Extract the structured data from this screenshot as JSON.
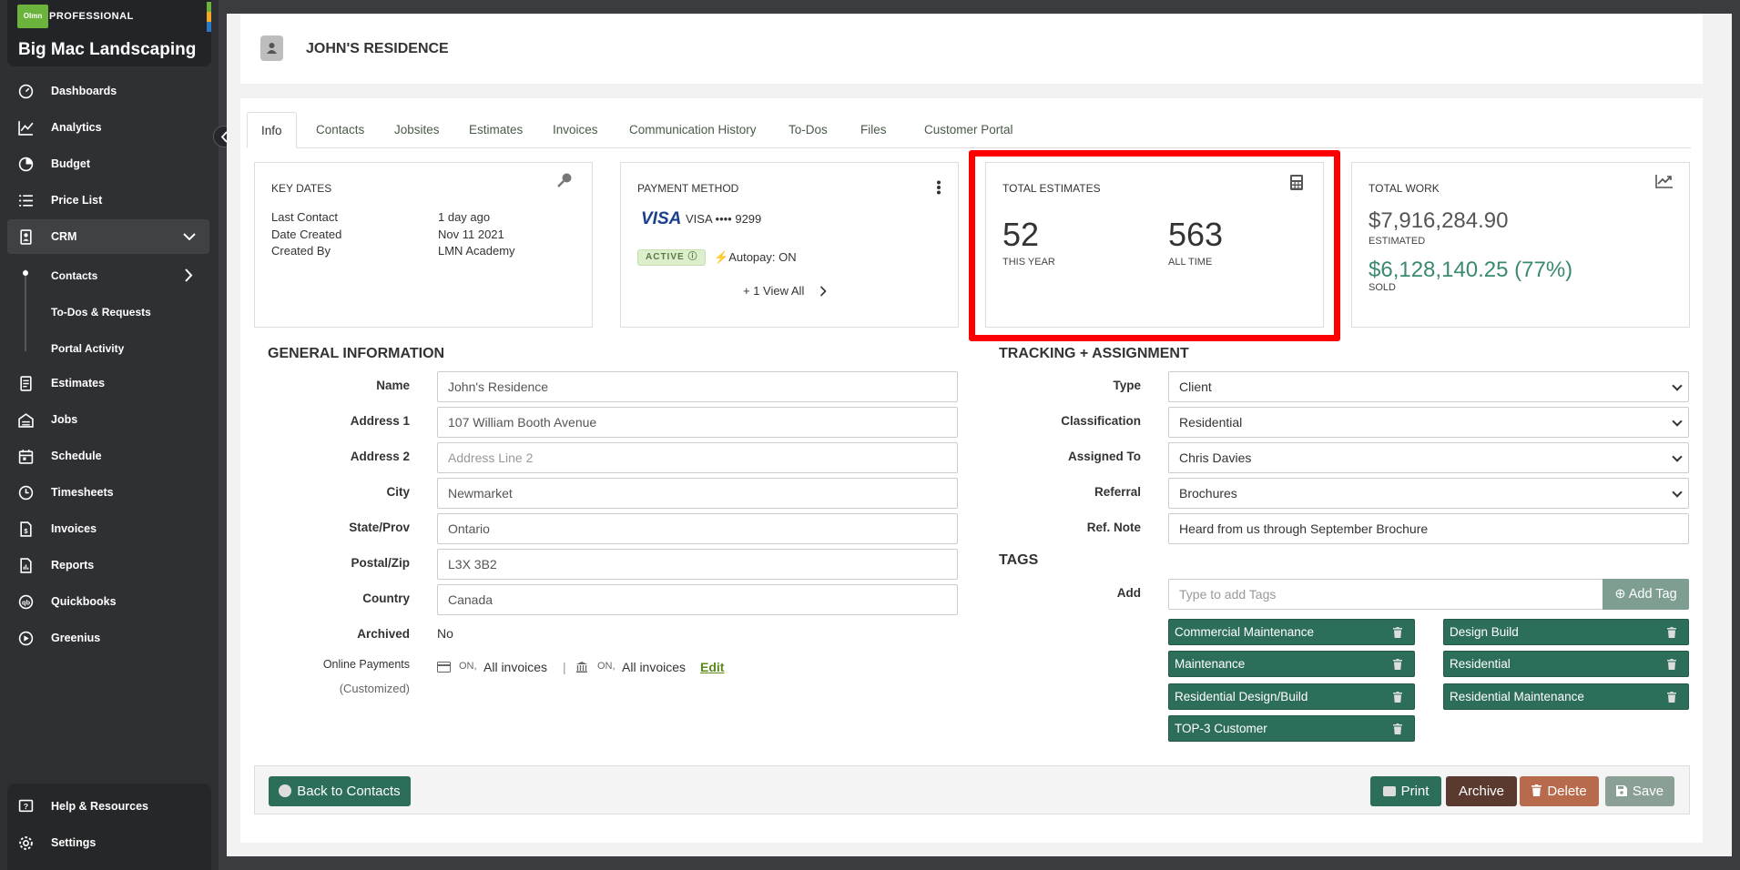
{
  "brand": {
    "logo_text": "Olmn",
    "tier": "PROFESSIONAL",
    "company": "Big Mac Landscaping"
  },
  "nav": [
    {
      "label": "Dashboards",
      "icon": "dashboard-icon"
    },
    {
      "label": "Analytics",
      "icon": "analytics-icon"
    },
    {
      "label": "Budget",
      "icon": "budget-icon"
    },
    {
      "label": "Price List",
      "icon": "price-list-icon"
    },
    {
      "label": "CRM",
      "icon": "crm-icon"
    },
    {
      "label": "Estimates",
      "icon": "estimates-icon"
    },
    {
      "label": "Jobs",
      "icon": "jobs-icon"
    },
    {
      "label": "Schedule",
      "icon": "schedule-icon"
    },
    {
      "label": "Timesheets",
      "icon": "timesheets-icon"
    },
    {
      "label": "Invoices",
      "icon": "invoices-icon"
    },
    {
      "label": "Reports",
      "icon": "reports-icon"
    },
    {
      "label": "Quickbooks",
      "icon": "quickbooks-icon"
    },
    {
      "label": "Greenius",
      "icon": "greenius-icon"
    }
  ],
  "crm_sub": [
    "Contacts",
    "To-Dos & Requests",
    "Portal Activity"
  ],
  "bottom_nav": [
    {
      "label": "Help & Resources"
    },
    {
      "label": "Settings"
    }
  ],
  "page": {
    "title": "JOHN'S RESIDENCE"
  },
  "tabs": [
    "Info",
    "Contacts",
    "Jobsites",
    "Estimates",
    "Invoices",
    "Communication History",
    "To-Dos",
    "Files",
    "Customer Portal"
  ],
  "key_dates": {
    "title": "KEY DATES",
    "rows": [
      {
        "label": "Last Contact",
        "value": "1 day ago"
      },
      {
        "label": "Date Created",
        "value": "Nov 11 2021"
      },
      {
        "label": "Created By",
        "value": "LMN Academy"
      }
    ]
  },
  "payment": {
    "title": "PAYMENT METHOD",
    "brand": "VISA",
    "card": "VISA •••• 9299",
    "status": "ACTIVE",
    "autopay": "Autopay: ON",
    "view_all": "+ 1 View All"
  },
  "estimates": {
    "title": "TOTAL ESTIMATES",
    "this_year": "52",
    "this_year_label": "THIS YEAR",
    "all_time": "563",
    "all_time_label": "ALL TIME"
  },
  "work": {
    "title": "TOTAL WORK",
    "estimated": "$7,916,284.90",
    "estimated_label": "ESTIMATED",
    "sold": "$6,128,140.25 (77%)",
    "sold_label": "SOLD"
  },
  "general": {
    "title": "GENERAL INFORMATION",
    "fields": [
      {
        "label": "Name",
        "value": "John's Residence",
        "placeholder": ""
      },
      {
        "label": "Address 1",
        "value": "107 William Booth Avenue",
        "placeholder": ""
      },
      {
        "label": "Address 2",
        "value": "",
        "placeholder": "Address Line 2"
      },
      {
        "label": "City",
        "value": "Newmarket",
        "placeholder": ""
      },
      {
        "label": "State/Prov",
        "value": "Ontario",
        "placeholder": ""
      },
      {
        "label": "Postal/Zip",
        "value": "L3X 3B2",
        "placeholder": ""
      },
      {
        "label": "Country",
        "value": "Canada",
        "placeholder": ""
      }
    ],
    "archived_label": "Archived",
    "archived_value": "No",
    "online_label": "Online Payments",
    "online_sub": "(Customized)",
    "card_state": "ON,",
    "card_scope": "All invoices",
    "sep": "|",
    "bank_state": "ON,",
    "bank_scope": "All invoices",
    "edit": "Edit"
  },
  "tracking": {
    "title": "TRACKING + ASSIGNMENT",
    "fields": [
      {
        "label": "Type",
        "value": "Client"
      },
      {
        "label": "Classification",
        "value": "Residential"
      },
      {
        "label": "Assigned To",
        "value": "Chris Davies"
      },
      {
        "label": "Referral",
        "value": "Brochures"
      }
    ],
    "ref_label": "Ref. Note",
    "ref_value": "Heard from us through September Brochure"
  },
  "tags": {
    "title": "TAGS",
    "add_label": "Add",
    "placeholder": "Type to add Tags",
    "add_button": "Add Tag",
    "items": [
      "Commercial Maintenance",
      "Design Build",
      "Maintenance",
      "Residential",
      "Residential Design/Build",
      "Residential Maintenance",
      "TOP-3 Customer"
    ]
  },
  "footer": {
    "back": "Back to Contacts",
    "print": "Print",
    "archive": "Archive",
    "delete": "Delete",
    "save": "Save"
  },
  "colors": {
    "accent": "#2d6e5a",
    "highlight": "#ff0000",
    "sold": "#3a8a6e"
  }
}
